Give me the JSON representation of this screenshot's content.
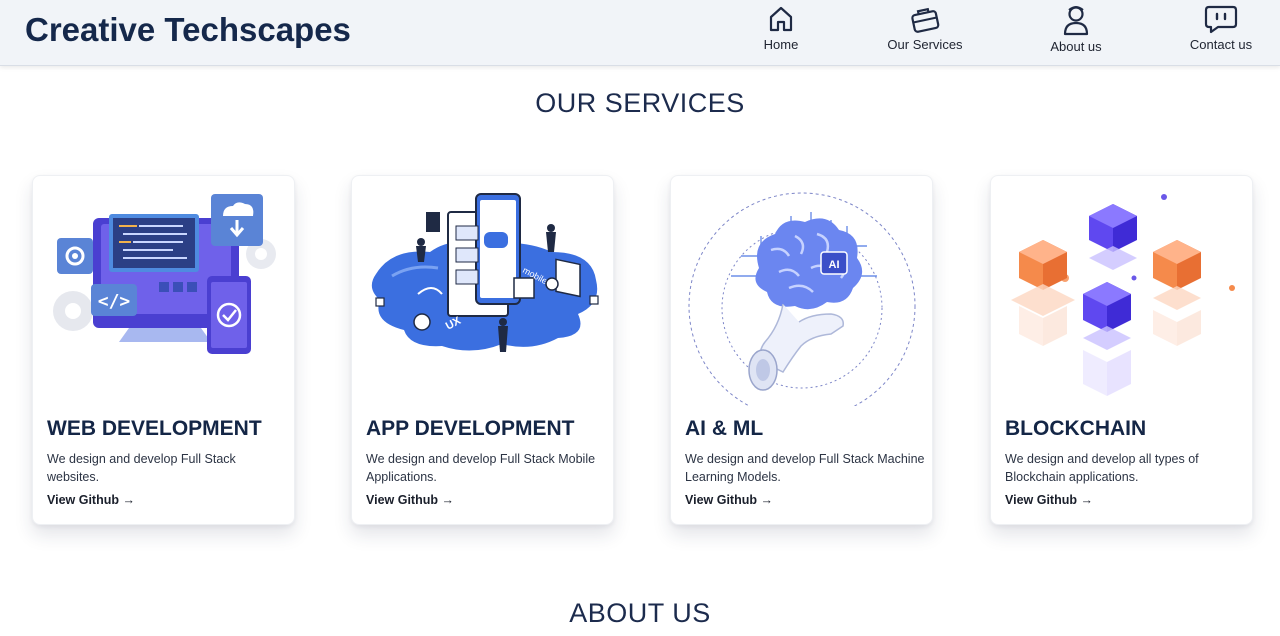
{
  "brand": {
    "name": "Creative Techscapes"
  },
  "nav": {
    "items": [
      {
        "label": "Home",
        "icon": "home-icon"
      },
      {
        "label": "Our Services",
        "icon": "briefcase-icon"
      },
      {
        "label": "About us",
        "icon": "person-icon"
      },
      {
        "label": "Contact us",
        "icon": "chat-icon"
      }
    ]
  },
  "services": {
    "title": "OUR SERVICES",
    "cards": [
      {
        "title": "WEB DEVELOPMENT",
        "description": "We design and develop Full Stack websites.",
        "link": "View Github →",
        "illustration": "web-development-illustration"
      },
      {
        "title": "APP DEVELOPMENT",
        "description": "We design and develop Full Stack Mobile Applications.",
        "link": "View Github →",
        "illustration": "app-development-illustration"
      },
      {
        "title": "AI & ML",
        "description": "We design and develop Full Stack Machine Learning Models.",
        "link": "View Github →",
        "illustration": "ai-brain-illustration"
      },
      {
        "title": "BLOCKCHAIN",
        "description": "We design and develop all types of Blockchain applications.",
        "link": "View Github →",
        "illustration": "blockchain-cubes-illustration"
      }
    ]
  },
  "about": {
    "title": "ABOUT US"
  },
  "colors": {
    "brand": "#15284b",
    "navbar_bg": "#f1f4f8",
    "accent_blue": "#3b6fe0",
    "accent_purple": "#5b3df0",
    "accent_orange": "#f58a4b"
  }
}
